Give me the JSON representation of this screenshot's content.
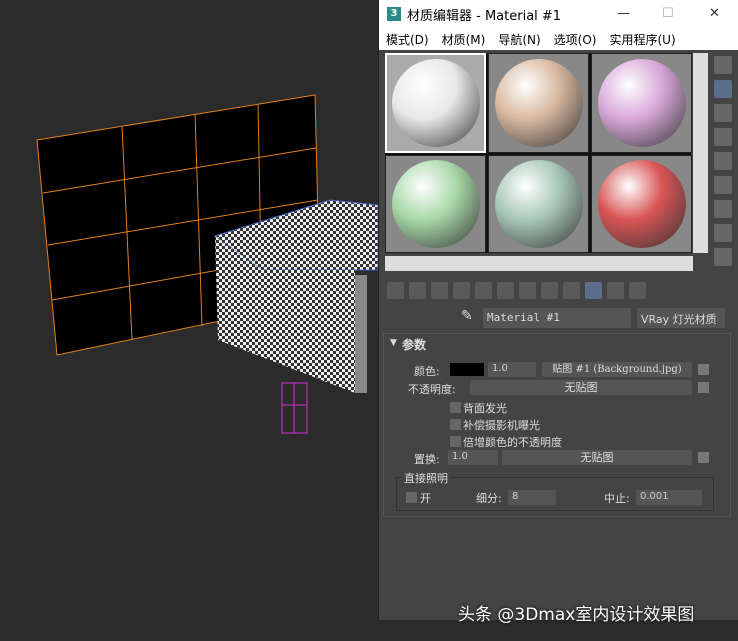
{
  "window": {
    "title": "材质编辑器 - Material #1",
    "logo": "3",
    "minimize": "—",
    "maximize": "☐",
    "close": "✕"
  },
  "menu": [
    "模式(D)",
    "材质(M)",
    "导航(N)",
    "选项(O)",
    "实用程序(U)"
  ],
  "slots": [
    {
      "color": "#e8e8e8"
    },
    {
      "color": "#d9b9a0"
    },
    {
      "color": "#d9a8d9"
    },
    {
      "color": "#a8d9a8"
    },
    {
      "color": "#a8c8b8"
    },
    {
      "color": "#d95555"
    }
  ],
  "material": {
    "name": "Material #1",
    "type": "VRay 灯光材质"
  },
  "params": {
    "header": "参数",
    "color_label": "颜色:",
    "color_value": "1.0",
    "color_map": "贴图 #1 (Background.jpg)",
    "opacity_label": "不透明度:",
    "opacity_map": "无贴图",
    "options": [
      "背面发光",
      "补偿摄影机曝光",
      "倍增颜色的不透明度"
    ],
    "displace_label": "置换:",
    "displace_value": "1.0",
    "displace_map": "无贴图",
    "direct_group": "直接照明",
    "on_label": "开",
    "subdiv_label": "细分:",
    "subdiv_value": "8",
    "cutoff_label": "中止:",
    "cutoff_value": "0.001"
  },
  "watermark": "头条 @3Dmax室内设计效果图"
}
